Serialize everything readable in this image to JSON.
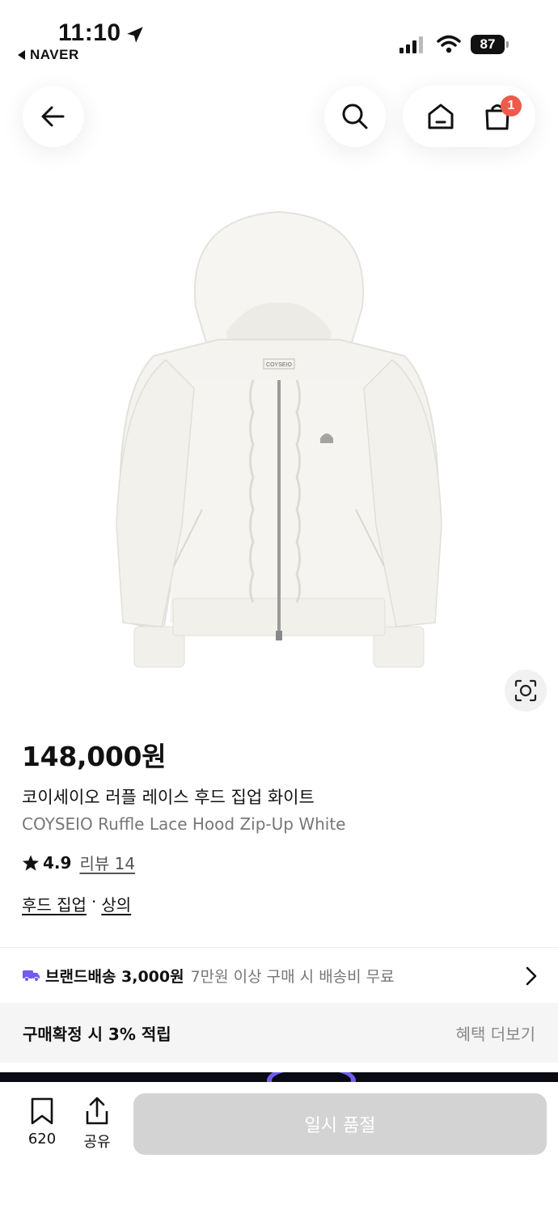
{
  "status_bar": {
    "time": "11:10",
    "back_app": "NAVER",
    "battery": "87"
  },
  "top_nav": {
    "cart_count": "1"
  },
  "product": {
    "price": "148,000원",
    "name_ko": "코이세이오 러플 레이스 후드 집업 화이트",
    "name_en": "COYSEIO Ruffle Lace Hood Zip-Up White",
    "rating": "4.9",
    "reviews": "리뷰 14",
    "category_1": "후드 집업",
    "category_sep": "·",
    "category_2": "상의",
    "image_label": "COYSEIO"
  },
  "shipping": {
    "label": "브랜드배송 3,000원",
    "note": "7만원 이상 구매 시 배송비 무료"
  },
  "points": {
    "left": "구매확정 시 3% 적립",
    "right": "혜택 더보기"
  },
  "bottom_bar": {
    "bookmark_count": "620",
    "share_label": "공유",
    "buy_button": "일시 품절"
  },
  "colors": {
    "badge": "#ef5a4c",
    "truck": "#6f5cf0",
    "disabled_button": "#d3d3d3"
  }
}
